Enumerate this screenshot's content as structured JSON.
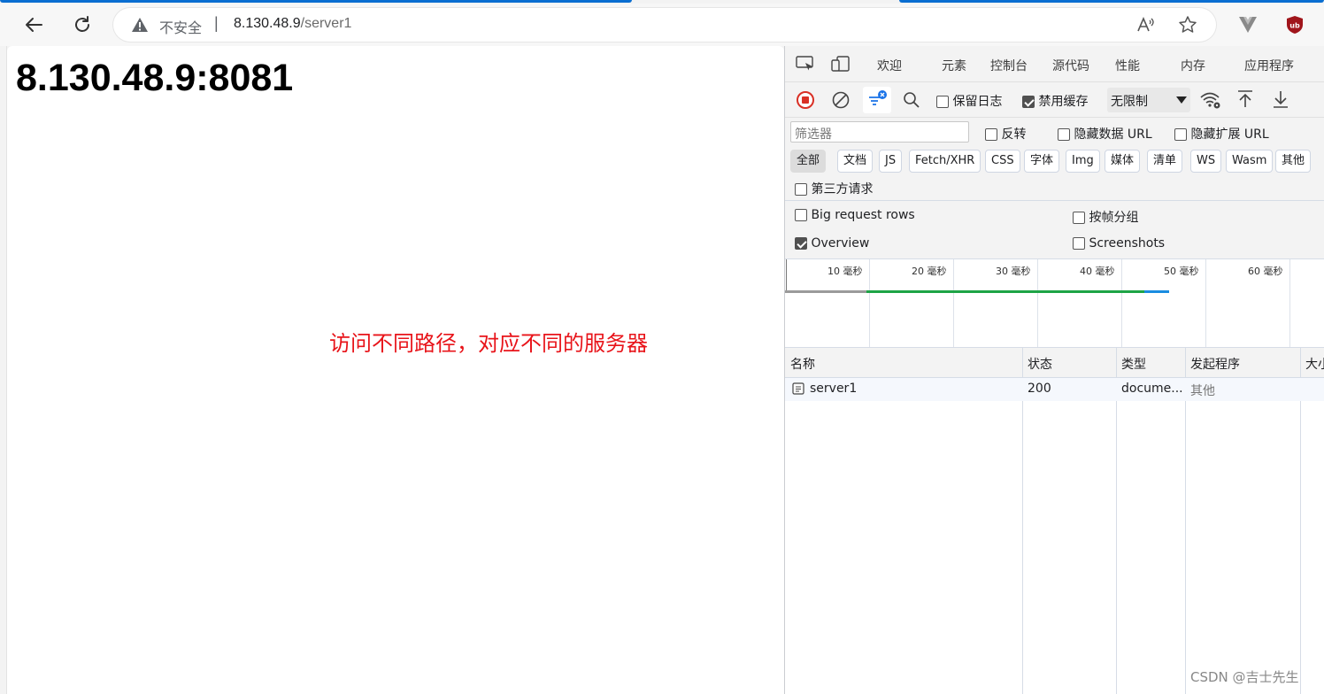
{
  "browser": {
    "security_label": "不安全",
    "separator": "|",
    "url_host": "8.130.48.9",
    "url_path": "/server1"
  },
  "page": {
    "heading": "8.130.48.9:8081",
    "annotation": "访问不同路径，对应不同的服务器"
  },
  "devtools": {
    "tabs": [
      "欢迎",
      "元素",
      "控制台",
      "源代码",
      "性能",
      "内存",
      "应用程序"
    ],
    "toolbar": {
      "preserve_log": "保留日志",
      "preserve_log_checked": false,
      "disable_cache": "禁用缓存",
      "disable_cache_checked": true,
      "throttle": "无限制"
    },
    "filter": {
      "placeholder": "筛选器",
      "invert": "反转",
      "hide_data_urls": "隐藏数据 URL",
      "hide_ext_urls": "隐藏扩展 URL",
      "types": [
        "全部",
        "文档",
        "JS",
        "Fetch/XHR",
        "CSS",
        "字体",
        "Img",
        "媒体",
        "清单",
        "WS",
        "Wasm",
        "其他"
      ],
      "third_party": "第三方请求"
    },
    "settings": {
      "big_rows": "Big request rows",
      "big_rows_checked": false,
      "group_by_frame": "按帧分组",
      "group_by_frame_checked": false,
      "overview": "Overview",
      "overview_checked": true,
      "screenshots": "Screenshots",
      "screenshots_checked": false
    },
    "timeline_ticks": [
      "10 毫秒",
      "20 毫秒",
      "30 毫秒",
      "40 毫秒",
      "50 毫秒",
      "60 毫秒"
    ],
    "table": {
      "headers": [
        "名称",
        "状态",
        "类型",
        "发起程序",
        "大小"
      ],
      "rows": [
        {
          "name": "server1",
          "status": "200",
          "type": "docume...",
          "initiator": "其他"
        }
      ]
    }
  },
  "watermark": "CSDN @吉士先生",
  "colors": {
    "annotation": "#e8141a",
    "accent": "#0a6ed1",
    "record": "#d93025",
    "timeline_green": "#1ea446",
    "timeline_blue": "#1a8ce0"
  }
}
